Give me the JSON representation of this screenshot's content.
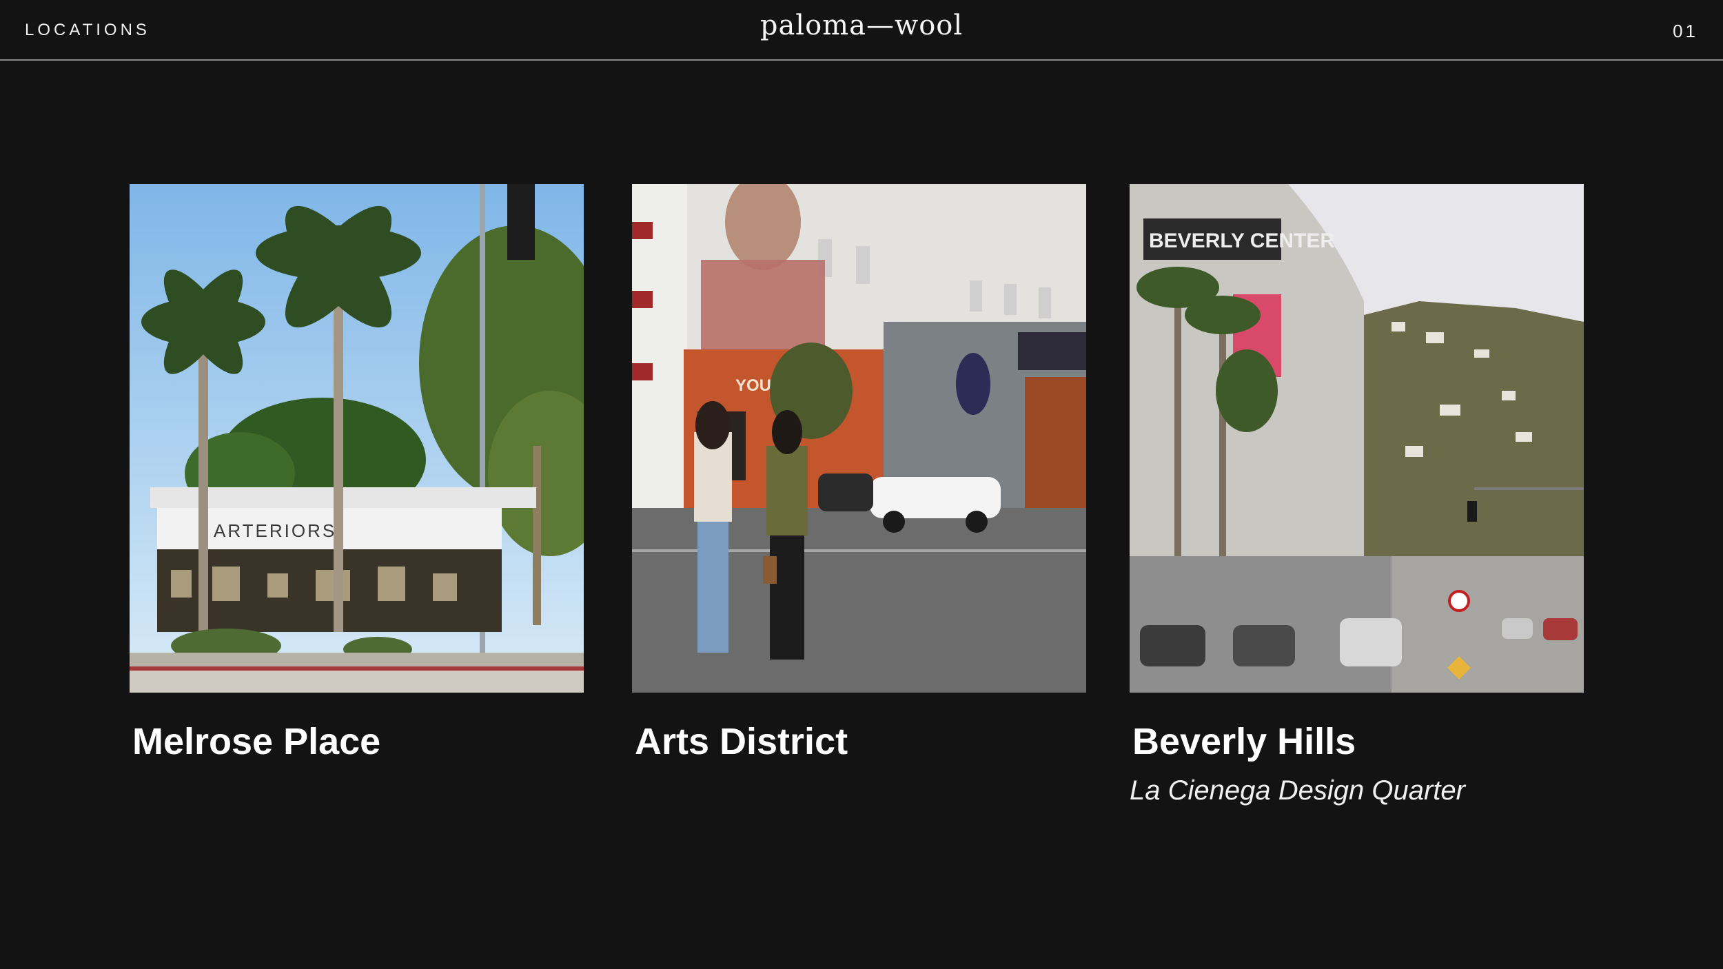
{
  "header": {
    "section_label": "LOCATIONS",
    "brand": "paloma—wool",
    "page_number": "01"
  },
  "locations": [
    {
      "name": "Melrose Place",
      "subtitle": "",
      "photo_icon": "melrose-storefront-photo",
      "photo_signage": "ARTERIORS"
    },
    {
      "name": "Arts District",
      "subtitle": "",
      "photo_icon": "arts-district-street-photo",
      "photo_signage": "YOU"
    },
    {
      "name": "Beverly Hills",
      "subtitle": "La Cienega Design Quarter",
      "photo_icon": "beverly-hills-street-photo",
      "photo_signage": "BEVERLY CENTER"
    }
  ],
  "colors": {
    "background": "#131313",
    "text": "#ffffff",
    "divider": "#8a8a8a"
  }
}
